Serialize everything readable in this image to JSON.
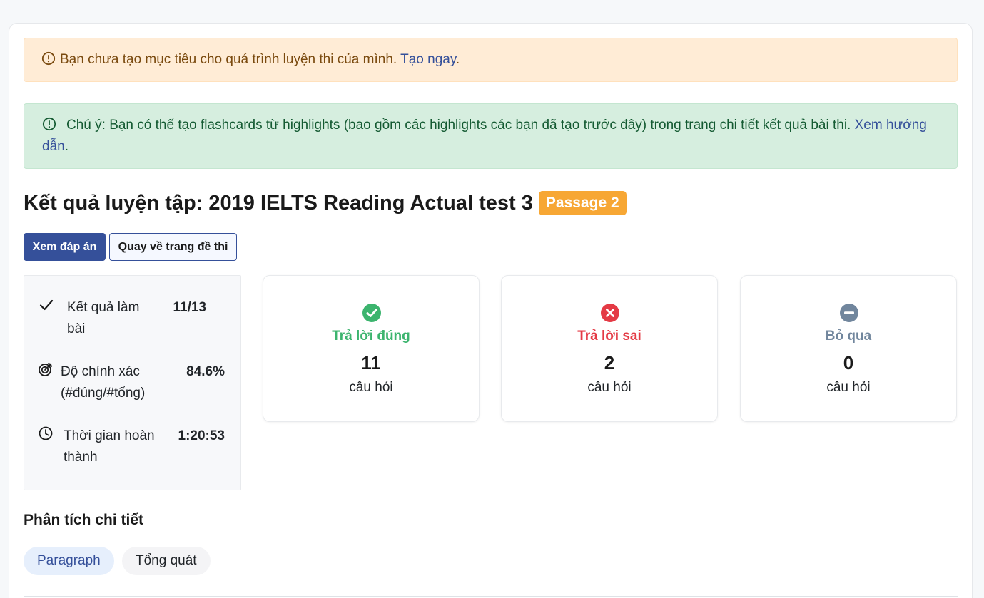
{
  "alerts": {
    "goal": {
      "text": "Bạn chưa tạo mục tiêu cho quá trình luyện thi của mình.",
      "link": "Tạo ngay",
      "suffix": "."
    },
    "flashcards": {
      "text": "Chú ý: Bạn có thể tạo flashcards từ highlights (bao gồm các highlights các bạn đã tạo trước đây) trong trang chi tiết kết quả bài thi.",
      "link": "Xem hướng dẫn",
      "suffix": "."
    }
  },
  "header": {
    "title": "Kết quả luyện tập: 2019 IELTS Reading Actual test 3",
    "badge": "Passage 2"
  },
  "actions": {
    "view_answers": "Xem đáp án",
    "back_to_test": "Quay về trang đề thi"
  },
  "summary": {
    "result": {
      "label_line1": "Kết quả làm",
      "label_line2": "bài",
      "value": "11/13",
      "icon": "check-icon"
    },
    "accuracy": {
      "label_line1": "Độ chính xác",
      "label_line2": "(#đúng/#tổng)",
      "value": "84.6%",
      "icon": "target-icon"
    },
    "time": {
      "label_line1": "Thời gian hoàn",
      "label_line2": "thành",
      "value": "1:20:53",
      "icon": "clock-icon"
    }
  },
  "results": {
    "correct": {
      "label": "Trả lời đúng",
      "count": "11",
      "unit": "câu hỏi",
      "color": "#3cb46e",
      "icon": "check-circle-icon"
    },
    "wrong": {
      "label": "Trả lời sai",
      "count": "2",
      "unit": "câu hỏi",
      "color": "#e43a45",
      "icon": "x-circle-icon"
    },
    "skipped": {
      "label": "Bỏ qua",
      "count": "0",
      "unit": "câu hỏi",
      "color": "#71869d",
      "icon": "minus-circle-icon"
    }
  },
  "analysis": {
    "title": "Phân tích chi tiết",
    "tabs": [
      {
        "label": "Paragraph",
        "active": true
      },
      {
        "label": "Tổng quát",
        "active": false
      }
    ]
  },
  "colors": {
    "primary": "#35509a",
    "badge": "#f7a734",
    "warning_bg": "#ffecd6",
    "success_bg": "#d6eedf"
  }
}
